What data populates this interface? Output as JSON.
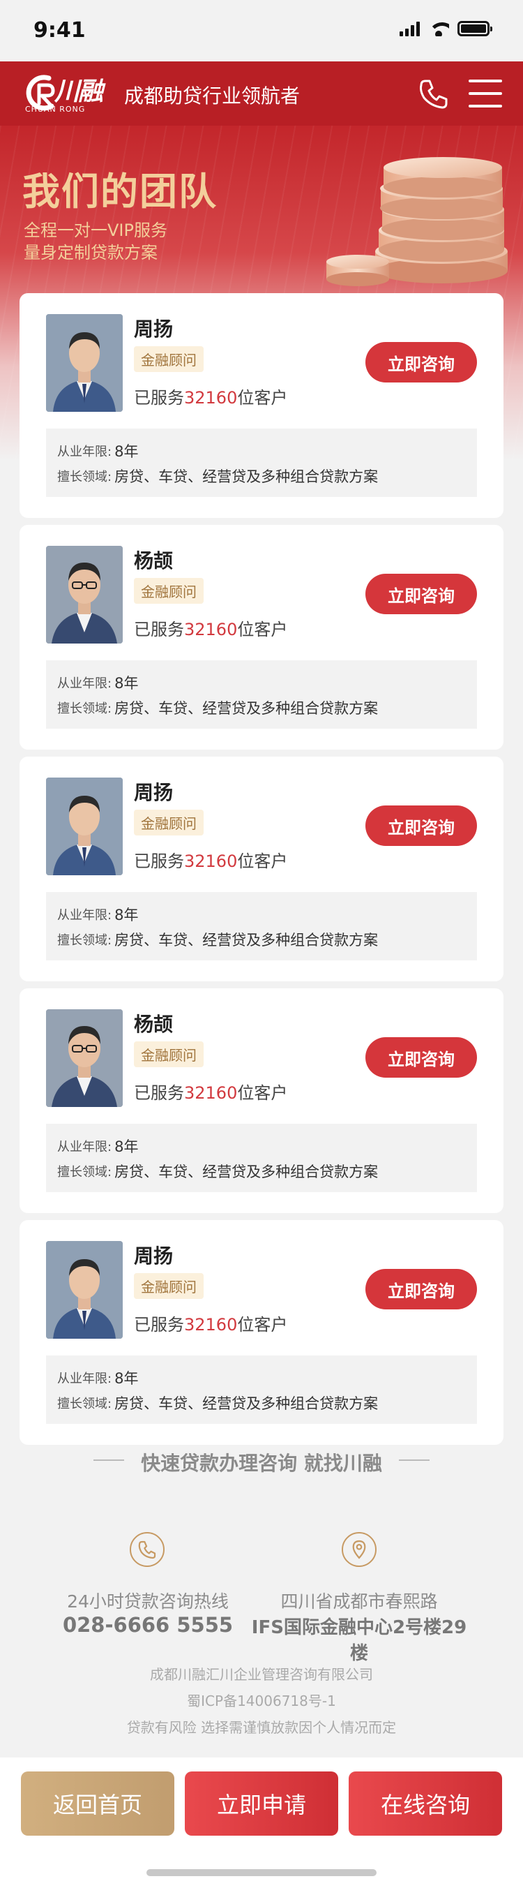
{
  "status_bar": {
    "time": "9:41"
  },
  "header": {
    "logo_script": "川融",
    "logo_en": "CHUAN RONG",
    "title": "成都助贷行业领航者"
  },
  "hero": {
    "title": "我们的团队",
    "subtitle_1": "全程一对一VIP服务",
    "subtitle_2": "量身定制贷款方案"
  },
  "labels": {
    "served_prefix": "已服务",
    "served_suffix": "位客户",
    "years_label": "从业年限:",
    "field_label": "擅长领域:",
    "consult_button": "立即咨询"
  },
  "advisors": [
    {
      "name": "周扬",
      "title": "金融顾问",
      "served": "32160",
      "years": "8年",
      "field": "房贷、车贷、经营贷及多种组合贷款方案"
    },
    {
      "name": "杨颉",
      "title": "金融顾问",
      "served": "32160",
      "years": "8年",
      "field": "房贷、车贷、经营贷及多种组合贷款方案"
    },
    {
      "name": "周扬",
      "title": "金融顾问",
      "served": "32160",
      "years": "8年",
      "field": "房贷、车贷、经营贷及多种组合贷款方案"
    },
    {
      "name": "杨颉",
      "title": "金融顾问",
      "served": "32160",
      "years": "8年",
      "field": "房贷、车贷、经营贷及多种组合贷款方案"
    },
    {
      "name": "周扬",
      "title": "金融顾问",
      "served": "32160",
      "years": "8年",
      "field": "房贷、车贷、经营贷及多种组合贷款方案"
    }
  ],
  "footer": {
    "heading": "快速贷款办理咨询 就找川融",
    "hotline_label": "24小时贷款咨询热线",
    "hotline_number": "028-6666 5555",
    "address_line_1": "四川省成都市春熙路",
    "address_line_2": "IFS国际金融中心2号楼29楼",
    "company": "成都川融汇川企业管理咨询有限公司",
    "icp": "蜀ICP备14006718号-1",
    "risk_notice": "贷款有风险  选择需谨慎放款因个人情况而定"
  },
  "bottom_bar": {
    "home": "返回首页",
    "apply": "立即申请",
    "online": "在线咨询"
  },
  "colors": {
    "brand_red": "#b81f25",
    "button_red": "#d5363b",
    "gold": "#c9a878",
    "hero_text": "#f3cf9b"
  }
}
